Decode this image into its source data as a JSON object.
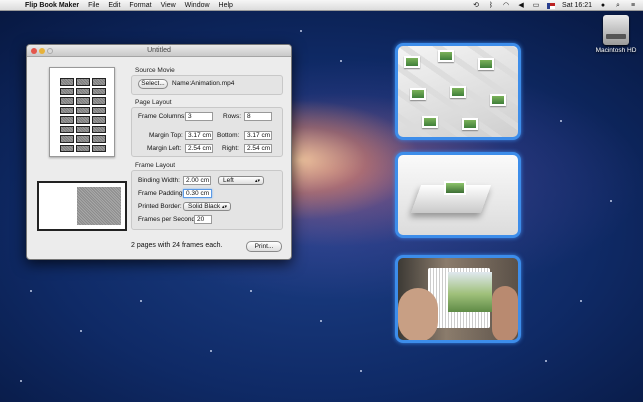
{
  "menubar": {
    "app_name": "Flip Book Maker",
    "items": [
      "File",
      "Edit",
      "Format",
      "View",
      "Window",
      "Help"
    ],
    "clock": "Sat 16:21"
  },
  "desktop": {
    "hd_label": "Macintosh HD"
  },
  "window": {
    "title": "Untitled",
    "source_movie": {
      "section": "Source Movie",
      "select_label": "Select...",
      "name_label": "Name:",
      "name_value": "Animation.mp4"
    },
    "page_layout": {
      "section": "Page Layout",
      "frame_columns_label": "Frame Columns:",
      "frame_columns_value": "3",
      "rows_label": "Rows:",
      "rows_value": "8",
      "margin_top_label": "Margin Top:",
      "margin_top_value": "3.17 cm",
      "bottom_label": "Bottom:",
      "bottom_value": "3.17 cm",
      "margin_left_label": "Margin Left:",
      "margin_left_value": "2.54 cm",
      "right_label": "Right:",
      "right_value": "2.54 cm"
    },
    "frame_layout": {
      "section": "Frame Layout",
      "binding_width_label": "Binding Width:",
      "binding_width_value": "2.00 cm",
      "binding_side_value": "Left",
      "frame_padding_label": "Frame Padding:",
      "frame_padding_value": "0.30 cm",
      "printed_border_label": "Printed Border:",
      "printed_border_value": "Solid Black",
      "fps_label": "Frames per Second:",
      "fps_value": "20"
    },
    "status": "2 pages with 24 frames each.",
    "print_label": "Print..."
  }
}
